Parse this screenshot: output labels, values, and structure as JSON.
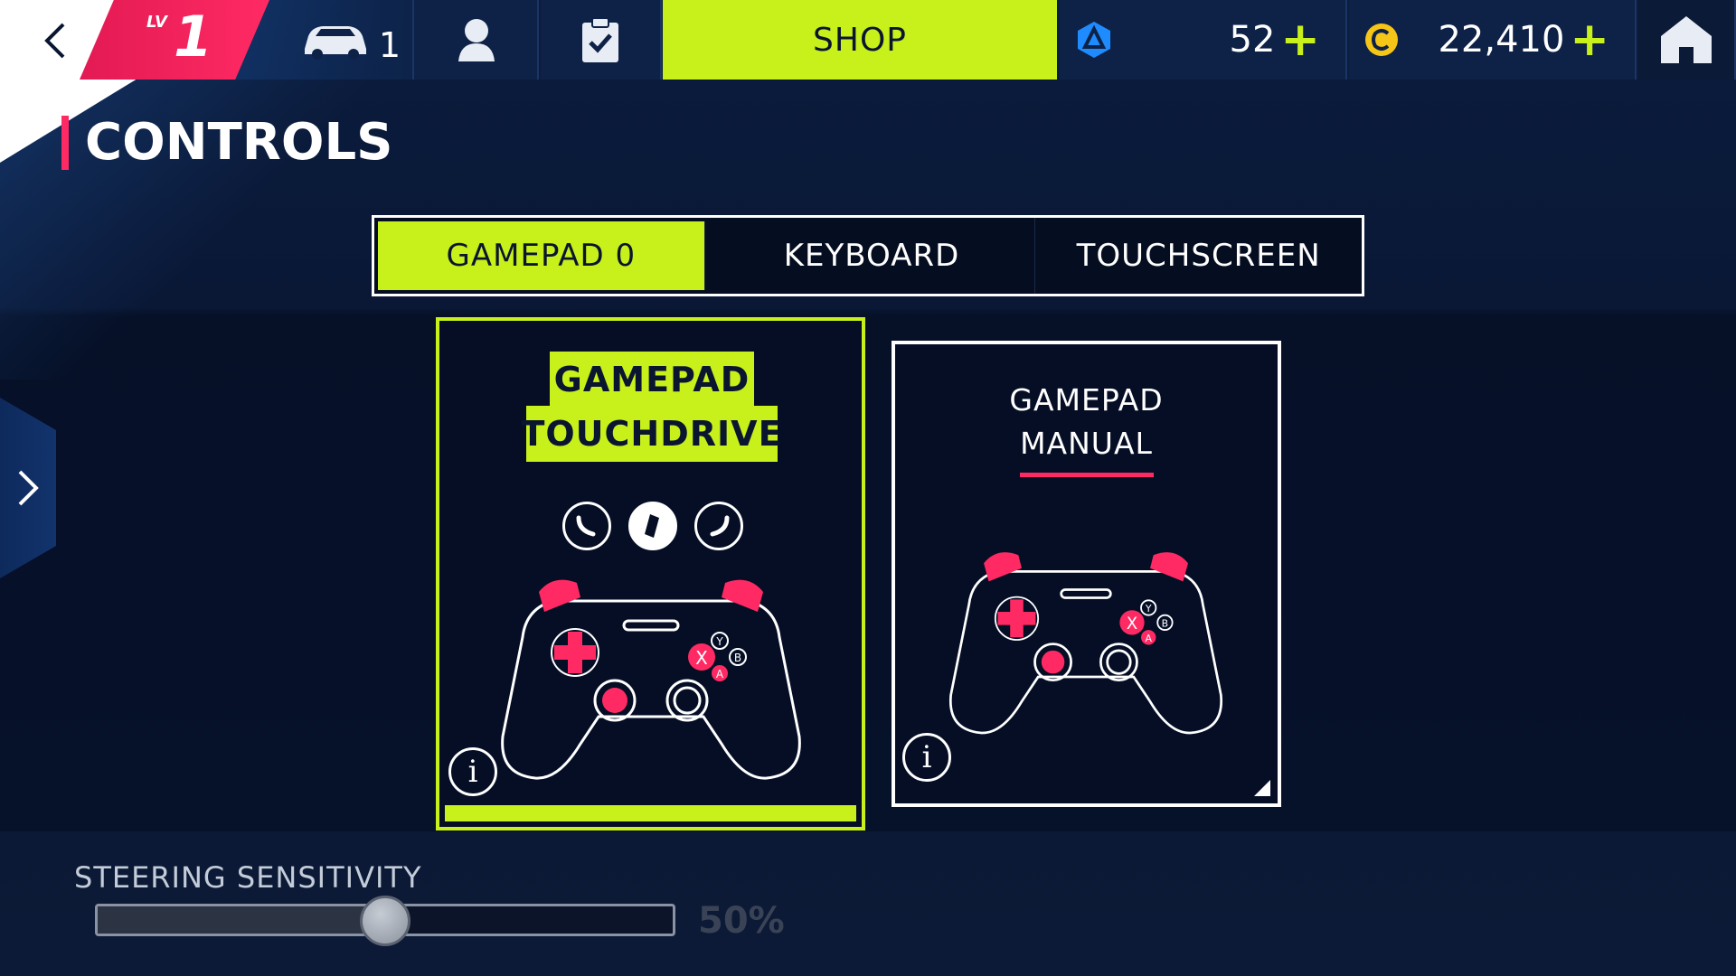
{
  "topbar": {
    "level_prefix": "LV",
    "level": "1",
    "cars_count": "1",
    "shop_label": "SHOP",
    "tokens": "52",
    "credits": "22,410",
    "plus": "+"
  },
  "page": {
    "title": "CONTROLS"
  },
  "tabs": [
    {
      "label": "GAMEPAD 0",
      "active": true
    },
    {
      "label": "KEYBOARD",
      "active": false
    },
    {
      "label": "TOUCHSCREEN",
      "active": false
    }
  ],
  "cards": {
    "touchdrive": {
      "line1": "GAMEPAD",
      "line2": "TOUCHDRIVE",
      "selected": true
    },
    "manual": {
      "line1": "GAMEPAD",
      "line2": "MANUAL",
      "selected": false
    }
  },
  "steering": {
    "label": "STEERING SENSITIVITY",
    "value_text": "50%",
    "value": 50
  },
  "colors": {
    "accent": "#c8f01a",
    "brand": "#ff2a63",
    "background": "#061027"
  },
  "info_label": "i"
}
